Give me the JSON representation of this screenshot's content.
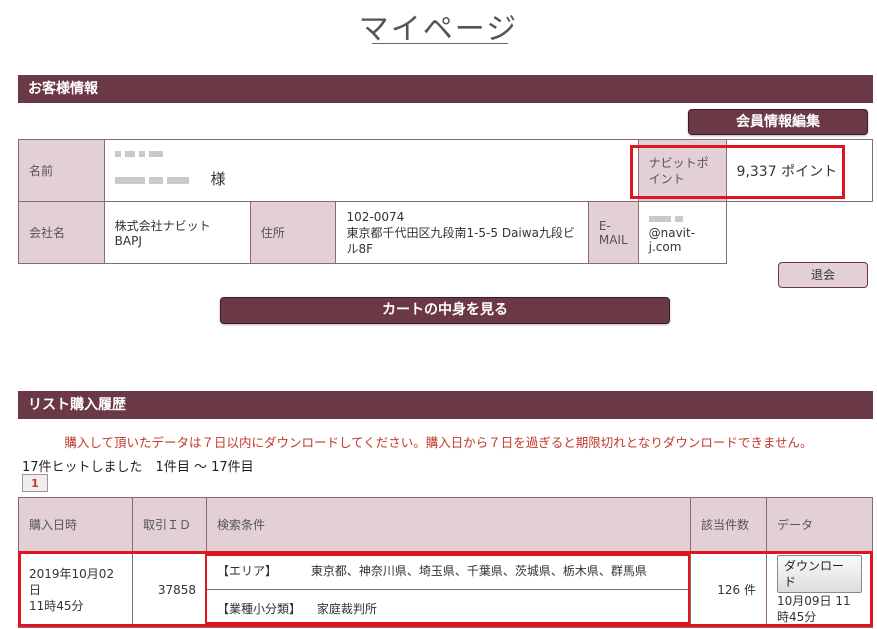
{
  "page": {
    "title": "マイページ"
  },
  "customer": {
    "section_title": "お客様情報",
    "edit_button": "会員情報編集",
    "name_label": "名前",
    "name_suffix": "様",
    "points_label": "ナビットポイント",
    "points_value": "9,337 ポイント",
    "company_label": "会社名",
    "company_value": "株式会社ナビット　BAPJ",
    "address_label": "住所",
    "postal_code": "102-0074",
    "address_value": "東京都千代田区九段南1-5-5 Daiwa九段ビル8F",
    "email_label": "E-MAIL",
    "email_suffix": "@navit-j.com",
    "withdraw_button": "退会",
    "cart_button": "カートの中身を見る"
  },
  "history": {
    "section_title": "リスト購入履歴",
    "notice": "購入して頂いたデータは７日以内にダウンロードしてください。購入日から７日を過ぎると期限切れとなりダウンロードできません。",
    "hits_text": "17件ヒットしました　1件目 ～ 17件目",
    "page_number": "1",
    "columns": [
      "購入日時",
      "取引ＩＤ",
      "検索条件",
      "該当件数",
      "データ"
    ],
    "rows": [
      {
        "date": "2019年10月02日",
        "time": "11時45分",
        "id": "37858",
        "condition_area_label": "【エリア】",
        "condition_area_value": "東京都、神奈川県、埼玉県、千葉県、茨城県、栃木県、群馬県",
        "condition_category_label": "【業種小分類】",
        "condition_category_value": "家庭裁判所",
        "count": "126 件",
        "download_button": "ダウンロード",
        "expiry": "10月09日 11時45分"
      }
    ]
  },
  "colors": {
    "accent": "#6b3845",
    "header_cell": "#e2d0d6",
    "highlight": "#e0151f",
    "notice": "#c0392b"
  }
}
